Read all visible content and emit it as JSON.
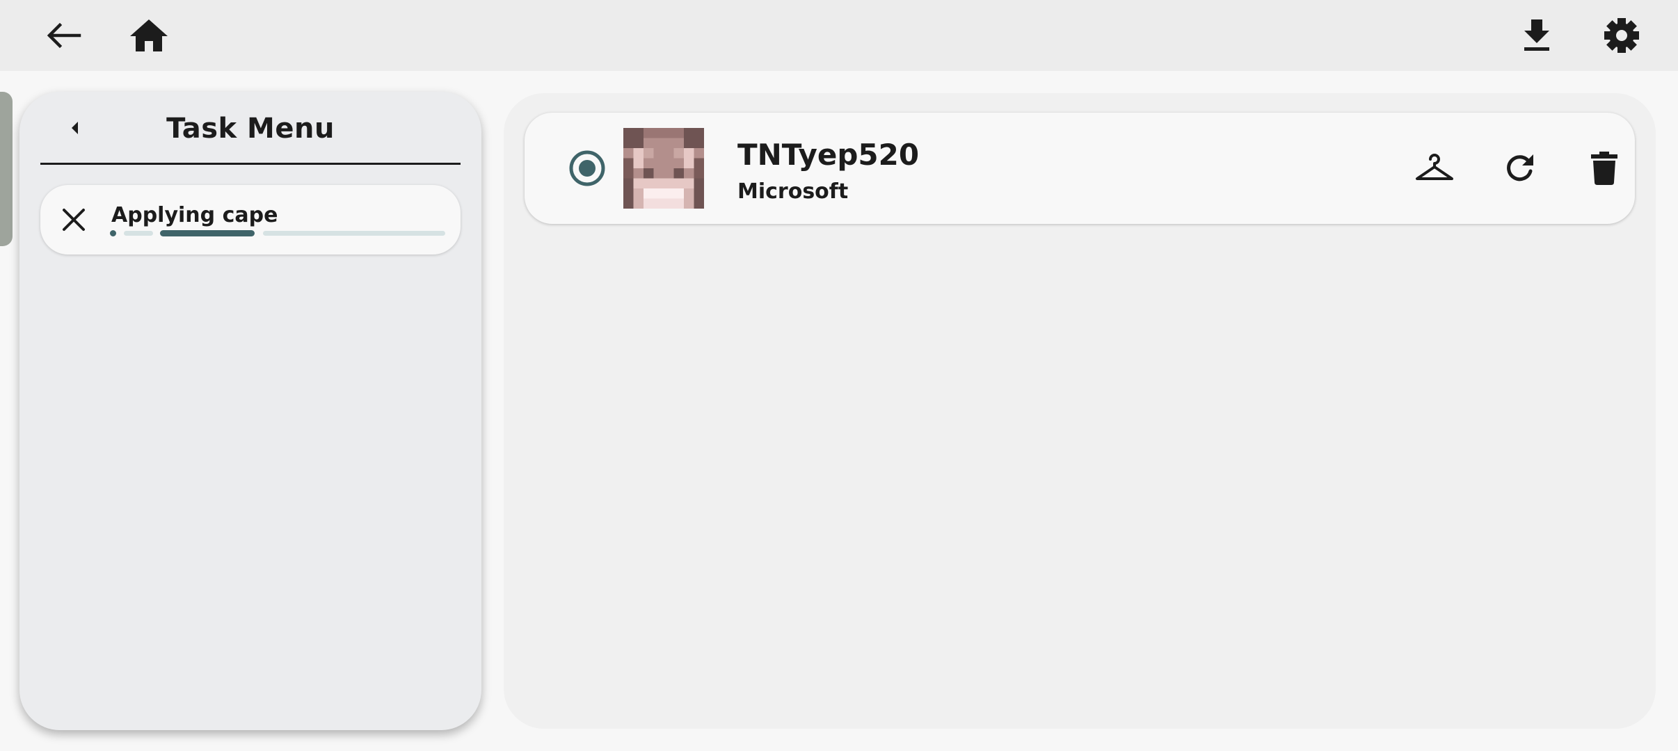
{
  "toolbar": {
    "back_icon": "arrow-left-icon",
    "home_icon": "home-icon",
    "download_icon": "download-icon",
    "settings_icon": "gear-icon"
  },
  "task_menu": {
    "title": "Task Menu",
    "collapse_icon": "caret-left-icon",
    "tasks": [
      {
        "label": "Applying cape",
        "cancel_icon": "close-icon",
        "status": "indeterminate progress"
      }
    ]
  },
  "accounts": [
    {
      "name": "TNTyep520",
      "type": "Microsoft",
      "selected": true,
      "avatar_icon": "player-head-avatar",
      "actions": [
        "hanger-icon",
        "refresh-icon",
        "trash-icon"
      ]
    }
  ],
  "colors": {
    "accent": "#3f6469",
    "accent_light": "#d6e2e3",
    "topbar": "#ececec",
    "panel": "#ebecee"
  }
}
